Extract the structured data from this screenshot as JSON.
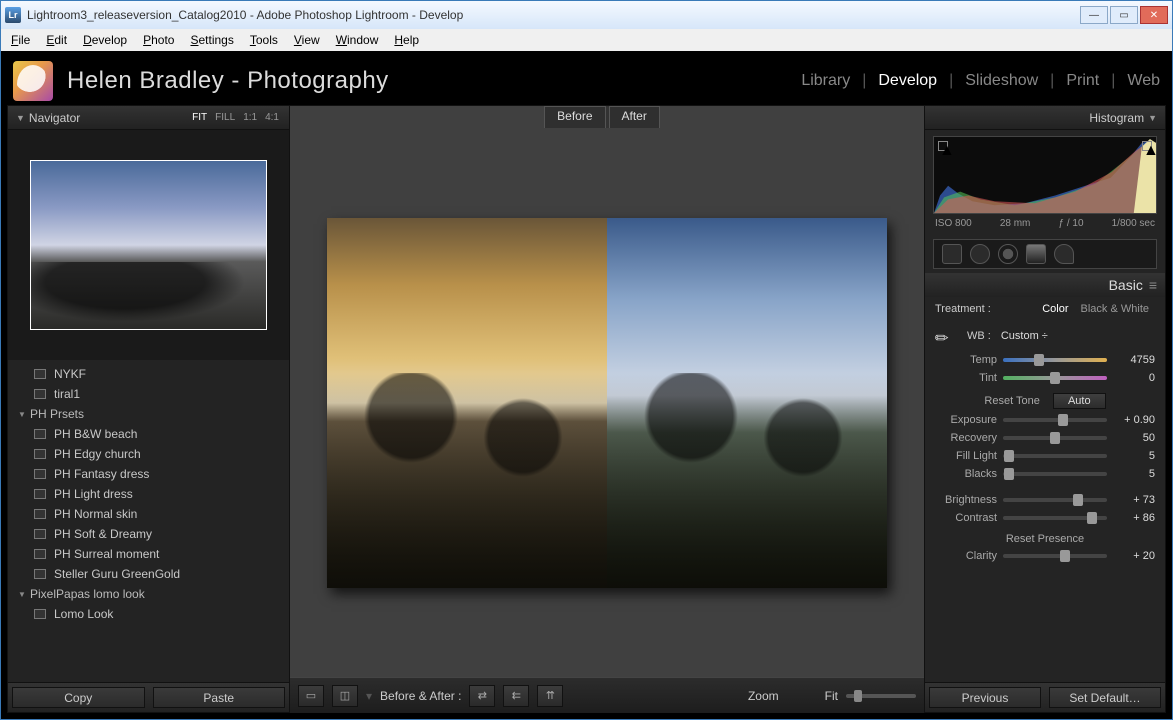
{
  "window": {
    "title": "Lightroom3_releaseversion_Catalog2010 - Adobe Photoshop Lightroom - Develop",
    "app_icon_text": "Lr"
  },
  "menubar": [
    "File",
    "Edit",
    "Develop",
    "Photo",
    "Settings",
    "Tools",
    "View",
    "Window",
    "Help"
  ],
  "identity": "Helen Bradley - Photography",
  "modules": {
    "items": [
      "Library",
      "Develop",
      "Slideshow",
      "Print",
      "Web"
    ],
    "active": "Develop"
  },
  "navigator": {
    "title": "Navigator",
    "zoom_modes": [
      "FIT",
      "FILL",
      "1:1",
      "4:1"
    ],
    "zoom_selected": "FIT"
  },
  "presets": [
    {
      "type": "item",
      "label": "NYKF"
    },
    {
      "type": "item",
      "label": "tiral1"
    },
    {
      "type": "group",
      "label": "PH Prsets"
    },
    {
      "type": "item",
      "label": "PH B&W beach"
    },
    {
      "type": "item",
      "label": "PH Edgy church"
    },
    {
      "type": "item",
      "label": "PH Fantasy dress"
    },
    {
      "type": "item",
      "label": "PH Light dress"
    },
    {
      "type": "item",
      "label": "PH Normal skin"
    },
    {
      "type": "item",
      "label": "PH Soft & Dreamy"
    },
    {
      "type": "item",
      "label": "PH Surreal moment"
    },
    {
      "type": "item",
      "label": "Steller Guru GreenGold"
    },
    {
      "type": "group",
      "label": "PixelPapas lomo look"
    },
    {
      "type": "item",
      "label": "Lomo Look"
    }
  ],
  "left_buttons": {
    "copy": "Copy",
    "paste": "Paste"
  },
  "center": {
    "before_label": "Before",
    "after_label": "After",
    "before_after_label": "Before & After :",
    "zoom_label": "Zoom",
    "fit_label": "Fit"
  },
  "histogram": {
    "title": "Histogram",
    "iso": "ISO 800",
    "focal": "28 mm",
    "aperture": "ƒ / 10",
    "shutter": "1/800 sec"
  },
  "basic": {
    "title": "Basic",
    "treatment_label": "Treatment :",
    "color": "Color",
    "bw": "Black & White",
    "wb_label": "WB :",
    "wb_value": "Custom ÷",
    "temp_label": "Temp",
    "temp_value": "4759",
    "tint_label": "Tint",
    "tint_value": "0",
    "reset_tone": "Reset Tone",
    "auto": "Auto",
    "exposure_label": "Exposure",
    "exposure_value": "+ 0.90",
    "recovery_label": "Recovery",
    "recovery_value": "50",
    "fill_label": "Fill Light",
    "fill_value": "5",
    "blacks_label": "Blacks",
    "blacks_value": "5",
    "brightness_label": "Brightness",
    "brightness_value": "+ 73",
    "contrast_label": "Contrast",
    "contrast_value": "+ 86",
    "reset_presence": "Reset Presence",
    "clarity_label": "Clarity",
    "clarity_value": "+ 20"
  },
  "right_buttons": {
    "previous": "Previous",
    "setdefault": "Set Default…"
  }
}
